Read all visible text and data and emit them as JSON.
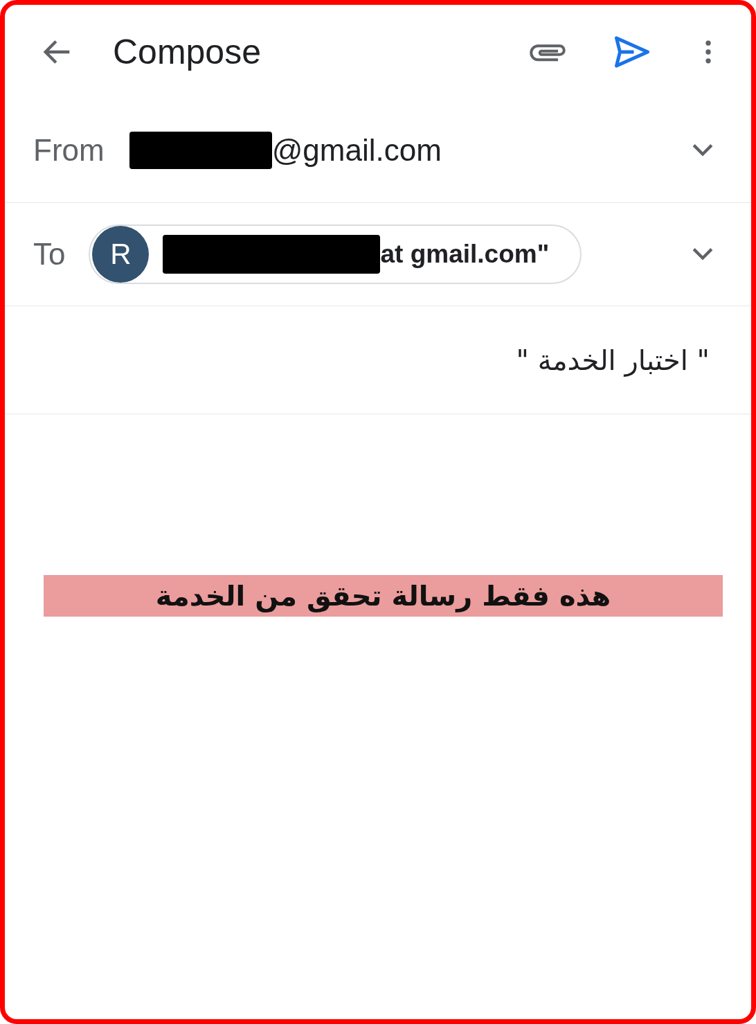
{
  "app_bar": {
    "title": "Compose"
  },
  "from": {
    "label": "From",
    "address_suffix": "@gmail.com",
    "redacted": true
  },
  "to": {
    "label": "To",
    "chip": {
      "initial": "R",
      "text": "at gmail.com\"",
      "redacted": true
    }
  },
  "subject": {
    "value": "\" اختبار الخدمة \""
  },
  "body": {
    "highlighted_text": "هذه فقط رسالة تحقق من الخدمة"
  }
}
